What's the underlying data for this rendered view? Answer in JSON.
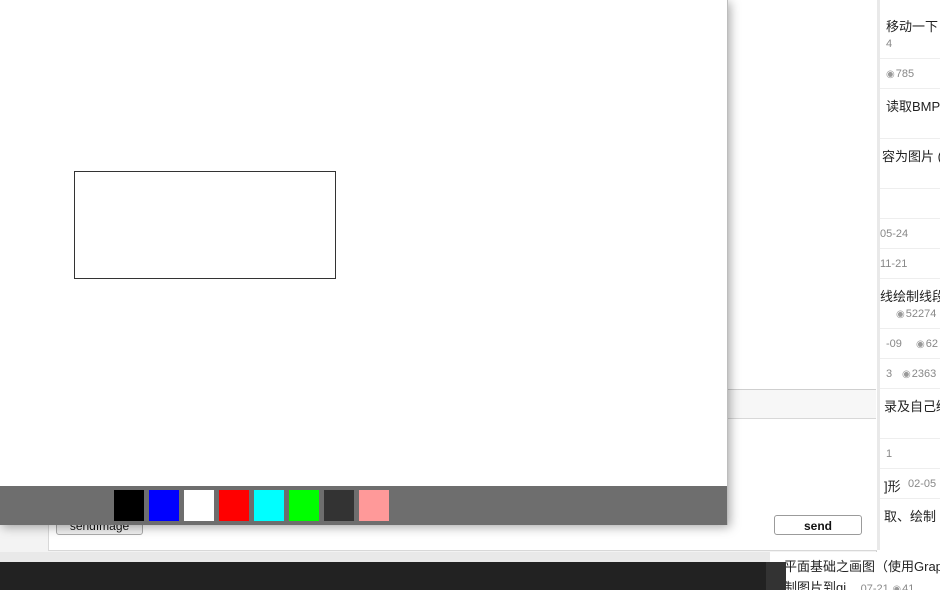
{
  "background_list": {
    "rows": [
      {
        "text": "移动一下",
        "kind": "title"
      },
      {
        "text": "4",
        "kind": "meta"
      },
      {
        "text": "785",
        "kind": "views"
      },
      {
        "text": "读取BMP",
        "kind": "title"
      },
      {
        "text": "容为图片 (",
        "kind": "title"
      },
      {
        "text": "05-24",
        "kind": "meta"
      },
      {
        "text": "11-21",
        "kind": "meta"
      },
      {
        "text": "线绘制线段",
        "kind": "title"
      },
      {
        "text": "52274",
        "kind": "views"
      },
      {
        "text": "-09",
        "kind": "meta"
      },
      {
        "text": "62",
        "kind": "views"
      },
      {
        "text": "3",
        "kind": "meta"
      },
      {
        "text": "2363",
        "kind": "views"
      },
      {
        "text": "录及自己绘",
        "kind": "title"
      },
      {
        "text": "1",
        "kind": "meta"
      },
      {
        "text": "]形",
        "kind": "title"
      },
      {
        "text": "02-05",
        "kind": "meta"
      },
      {
        "text": "取、绘制",
        "kind": "title"
      }
    ],
    "bottom_rows": [
      {
        "text": "平面基础之画图（使用Grap"
      },
      {
        "text": "制图片到gi...",
        "date": "07-21",
        "views": "41"
      }
    ]
  },
  "chat": {
    "send_label": "send",
    "sendimage_label": "sendImage"
  },
  "palette": {
    "colors": [
      {
        "name": "black",
        "hex": "#000000"
      },
      {
        "name": "blue",
        "hex": "#0000ff"
      },
      {
        "name": "white",
        "hex": "#ffffff"
      },
      {
        "name": "red",
        "hex": "#ff0000"
      },
      {
        "name": "cyan",
        "hex": "#00ffff"
      },
      {
        "name": "green",
        "hex": "#00ff00"
      },
      {
        "name": "dark-gray",
        "hex": "#333333"
      },
      {
        "name": "pink",
        "hex": "#ff9999"
      }
    ]
  }
}
